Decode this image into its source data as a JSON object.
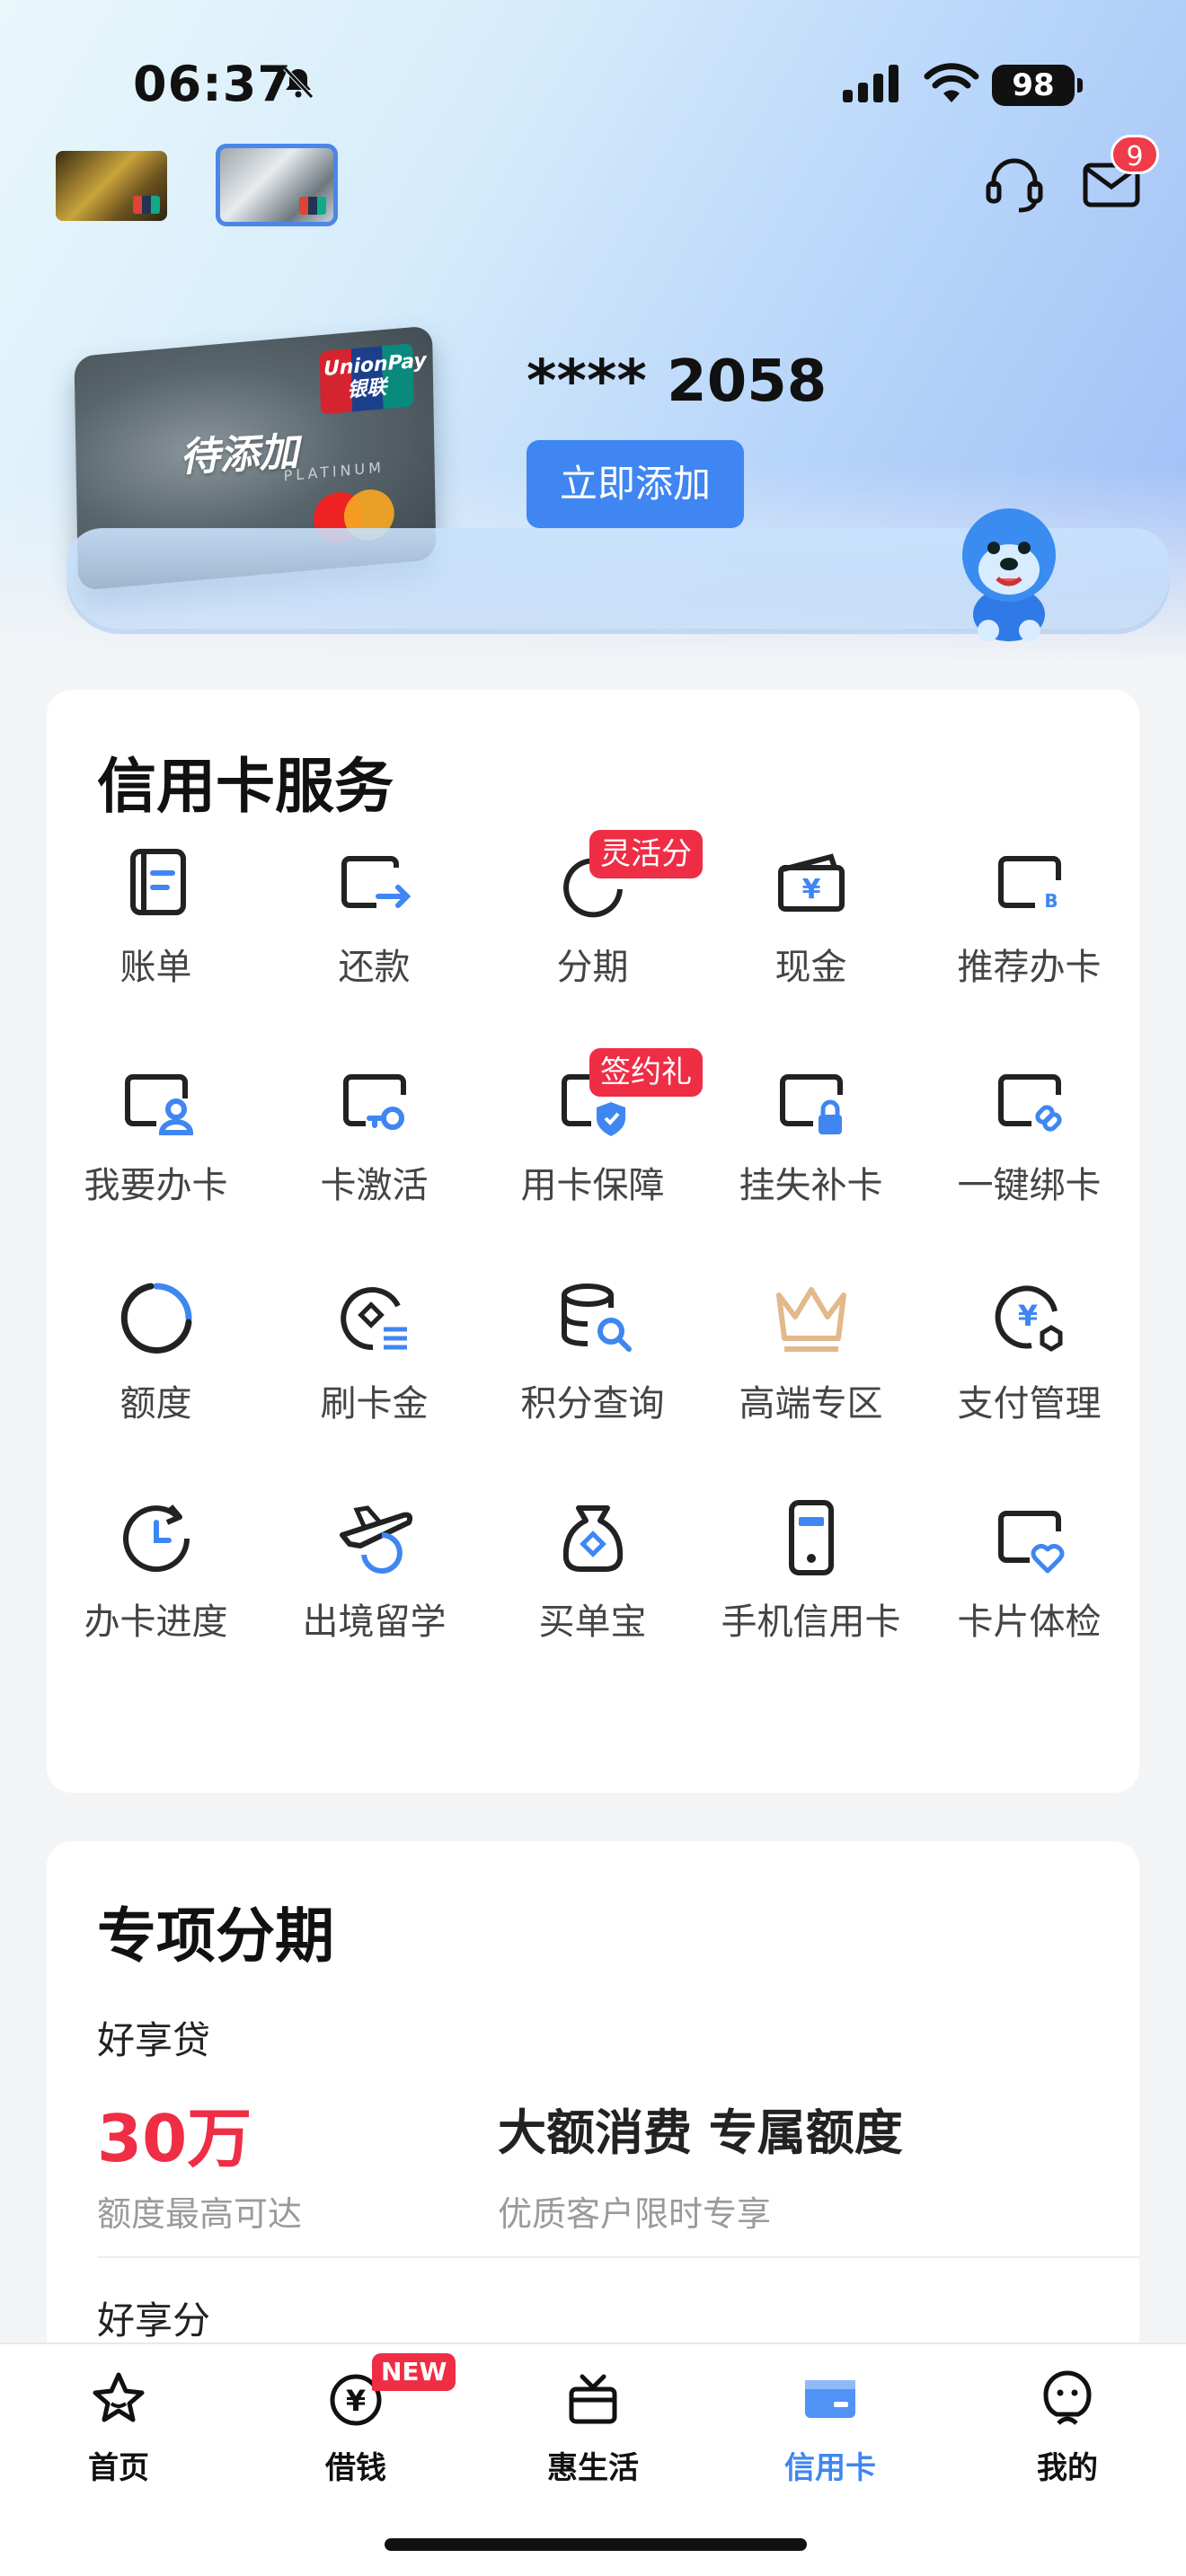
{
  "status_bar": {
    "time": "06:37",
    "battery": "98"
  },
  "header": {
    "message_badge": "9"
  },
  "card": {
    "pending_label": "待添加",
    "masked_number": "**** 2058",
    "add_button": "立即添加"
  },
  "services": {
    "title": "信用卡服务",
    "items": [
      {
        "label": "账单",
        "icon": "bill-icon"
      },
      {
        "label": "还款",
        "icon": "repay-icon"
      },
      {
        "label": "分期",
        "icon": "installment-icon",
        "tag": "灵活分"
      },
      {
        "label": "现金",
        "icon": "cash-icon"
      },
      {
        "label": "推荐办卡",
        "icon": "recommend-card-icon"
      },
      {
        "label": "我要办卡",
        "icon": "apply-card-icon"
      },
      {
        "label": "卡激活",
        "icon": "activate-card-icon"
      },
      {
        "label": "用卡保障",
        "icon": "card-protection-icon",
        "tag": "签约礼"
      },
      {
        "label": "挂失补卡",
        "icon": "lost-card-icon"
      },
      {
        "label": "一键绑卡",
        "icon": "bind-card-icon"
      },
      {
        "label": "额度",
        "icon": "credit-limit-icon"
      },
      {
        "label": "刷卡金",
        "icon": "swipe-reward-icon"
      },
      {
        "label": "积分查询",
        "icon": "points-query-icon"
      },
      {
        "label": "高端专区",
        "icon": "premium-crown-icon"
      },
      {
        "label": "支付管理",
        "icon": "payment-manage-icon"
      },
      {
        "label": "办卡进度",
        "icon": "progress-icon"
      },
      {
        "label": "出境留学",
        "icon": "travel-study-icon"
      },
      {
        "label": "买单宝",
        "icon": "bill-bag-icon"
      },
      {
        "label": "手机信用卡",
        "icon": "mobile-card-icon"
      },
      {
        "label": "卡片体检",
        "icon": "card-checkup-icon"
      }
    ]
  },
  "special": {
    "title": "专项分期",
    "product1": {
      "name": "好享贷",
      "amount": "30万",
      "amount_note": "额度最高可达",
      "slogan": "大额消费 专属额度",
      "slogan_note": "优质客户限时专享"
    },
    "product2": {
      "name": "好享分"
    }
  },
  "tabbar": {
    "tabs": [
      {
        "label": "首页",
        "icon": "star-icon"
      },
      {
        "label": "借钱",
        "icon": "yuan-coin-icon",
        "tag": "NEW"
      },
      {
        "label": "惠生活",
        "icon": "gift-box-icon"
      },
      {
        "label": "信用卡",
        "icon": "credit-card-icon",
        "active": true
      },
      {
        "label": "我的",
        "icon": "profile-icon"
      }
    ]
  },
  "colors": {
    "accent": "#3f86f2",
    "red": "#ef2d45"
  }
}
